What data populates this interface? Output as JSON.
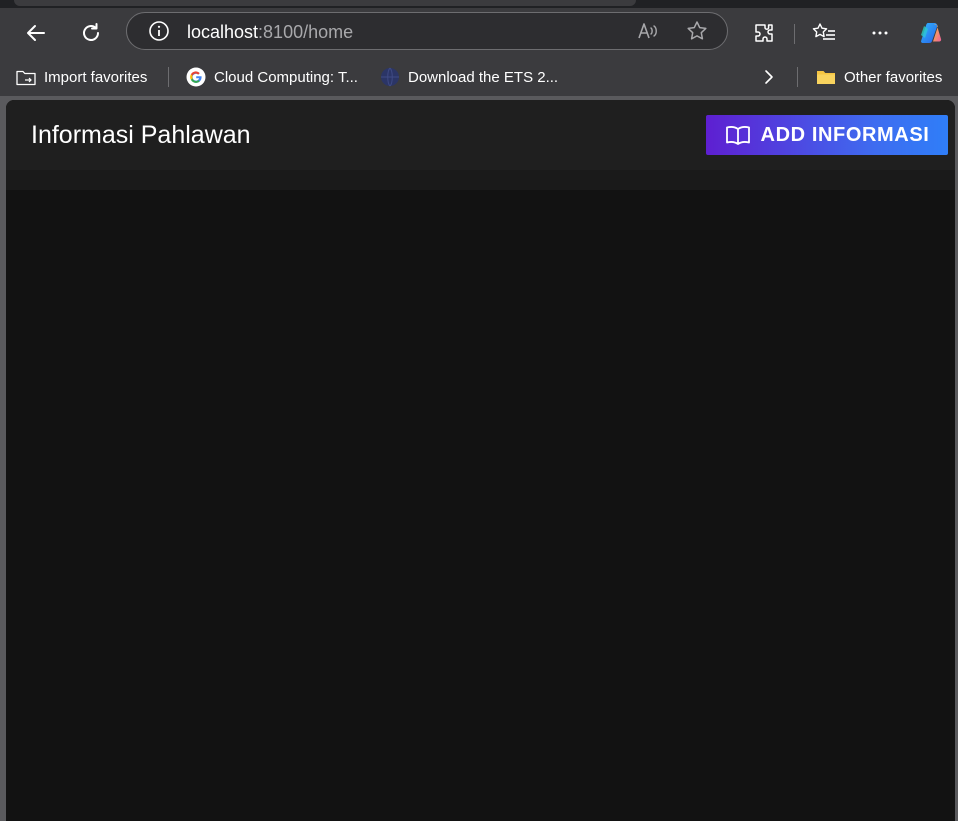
{
  "browser": {
    "address_host": "localhost",
    "address_rest": ":8100/home",
    "bookmarks": {
      "import_label": "Import favorites",
      "cloud_label": "Cloud Computing: T...",
      "ets_label": "Download the ETS 2...",
      "other_label": "Other favorites"
    }
  },
  "app": {
    "title": "Informasi Pahlawan",
    "add_button_label": "ADD INFORMASI",
    "accent_start": "#5e1fd1",
    "accent_end": "#2f7ef8"
  }
}
